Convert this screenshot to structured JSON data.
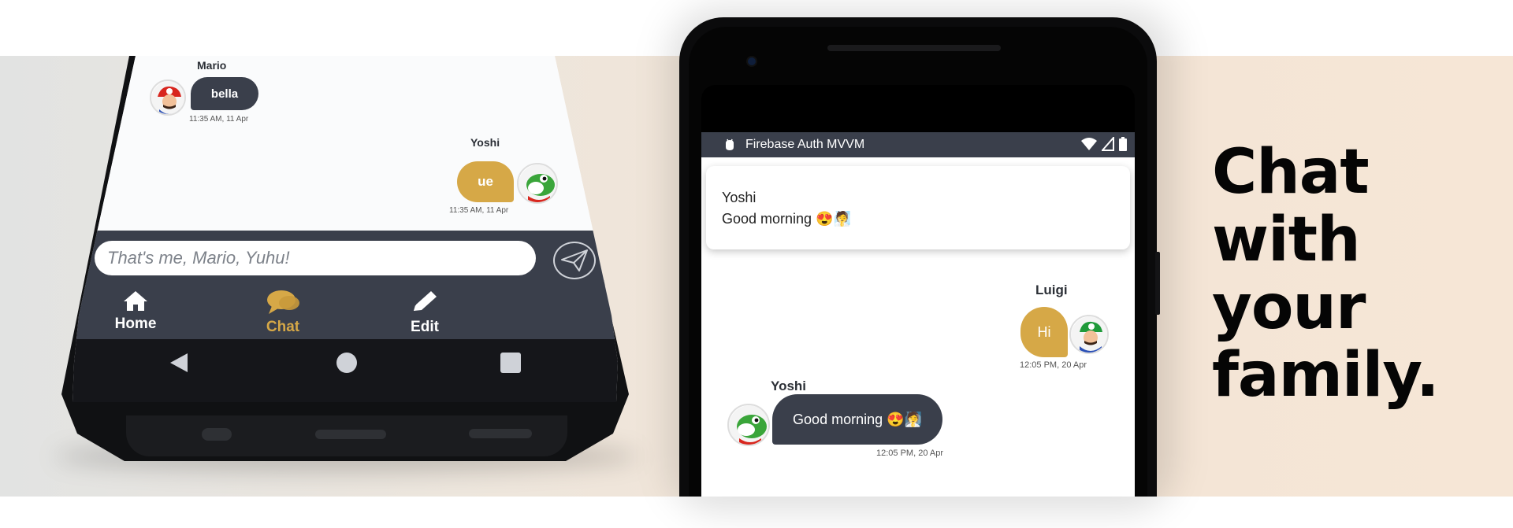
{
  "headline": {
    "lines": [
      "Chat",
      "with",
      "your",
      "family."
    ]
  },
  "left_phone": {
    "messages": [
      {
        "sender": "Mario",
        "text": "bella",
        "time": "11:35 AM, 11 Apr",
        "avatar": "mario-avatar",
        "side": "left",
        "bubble_color": "#3a3f4b"
      },
      {
        "sender": "Yoshi",
        "text": "ue",
        "time": "11:35 AM, 11 Apr",
        "avatar": "yoshi-avatar",
        "side": "right",
        "bubble_color": "#d6a847"
      }
    ],
    "input": {
      "value": "That's me, Mario, Yuhu!"
    },
    "nav": [
      {
        "label": "Home",
        "icon": "home-icon"
      },
      {
        "label": "Chat",
        "icon": "chat-icon"
      },
      {
        "label": "Edit",
        "icon": "pencil-icon"
      }
    ],
    "nav_active": "Chat",
    "system_nav": [
      "back-icon",
      "home-circle-icon",
      "recents-icon"
    ]
  },
  "right_phone": {
    "status_bar": {
      "app_title": "Firebase Auth MVVM",
      "icons": [
        "wifi-icon",
        "signal-icon",
        "battery-icon"
      ]
    },
    "notification": {
      "title": "Yoshi",
      "body": "Good morning 😍🧖"
    },
    "messages": [
      {
        "sender": "Luigi",
        "text": "Hi",
        "time": "12:05 PM, 20 Apr",
        "avatar": "luigi-avatar",
        "side": "right",
        "bubble_color": "#d6a847"
      },
      {
        "sender": "Yoshi",
        "text": "Good morning 😍🧖",
        "time": "12:05 PM, 20 Apr",
        "avatar": "yoshi-avatar",
        "side": "left",
        "bubble_color": "#3a3f4b"
      }
    ]
  },
  "colors": {
    "accent": "#d6a847",
    "dark_bubble": "#3a3f4b",
    "nav_bar": "#3a3f4b"
  }
}
